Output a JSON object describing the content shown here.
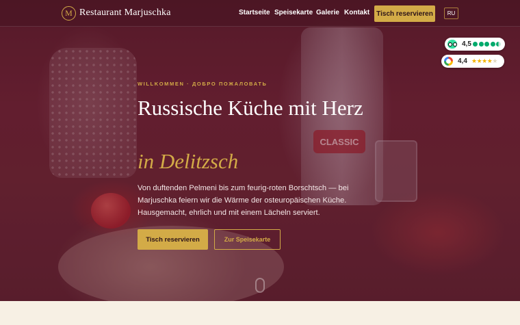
{
  "header": {
    "logo_letter": "M",
    "brand": "Restaurant Marjuschka",
    "nav": [
      "Startseite",
      "Speisekarte",
      "Galerie",
      "Kontakt"
    ],
    "reserve_label": "Tisch reservieren",
    "language": "RU"
  },
  "ratings": {
    "tripadvisor": {
      "icon": "tripadvisor-icon",
      "value": "4,5",
      "dots": 4.5
    },
    "google": {
      "icon": "google-icon",
      "value": "4,4",
      "stars": 4.4
    }
  },
  "hero": {
    "eyebrow": "WILLKOMMEN · ДОБРО ПОЖАЛОВАТЬ",
    "title": "Russische Küche mit Herz",
    "title_accent": "in Delitzsch",
    "lead": "Von duftenden Pelmeni bis zum feurig-roten Borschtsch — bei Marjuschka feiern wir die Wärme der osteuropäischen Küche. Hausgemacht, ehrlich und mit einem Lächeln serviert.",
    "primary_button": "Tisch reservieren",
    "secondary_button": "Zur Speisekarte",
    "photo_label": "CLASSIC"
  },
  "colors": {
    "accent": "#d3ab47",
    "hero_tint": "#5a1f2c",
    "page_bg": "#f7f0e4"
  }
}
